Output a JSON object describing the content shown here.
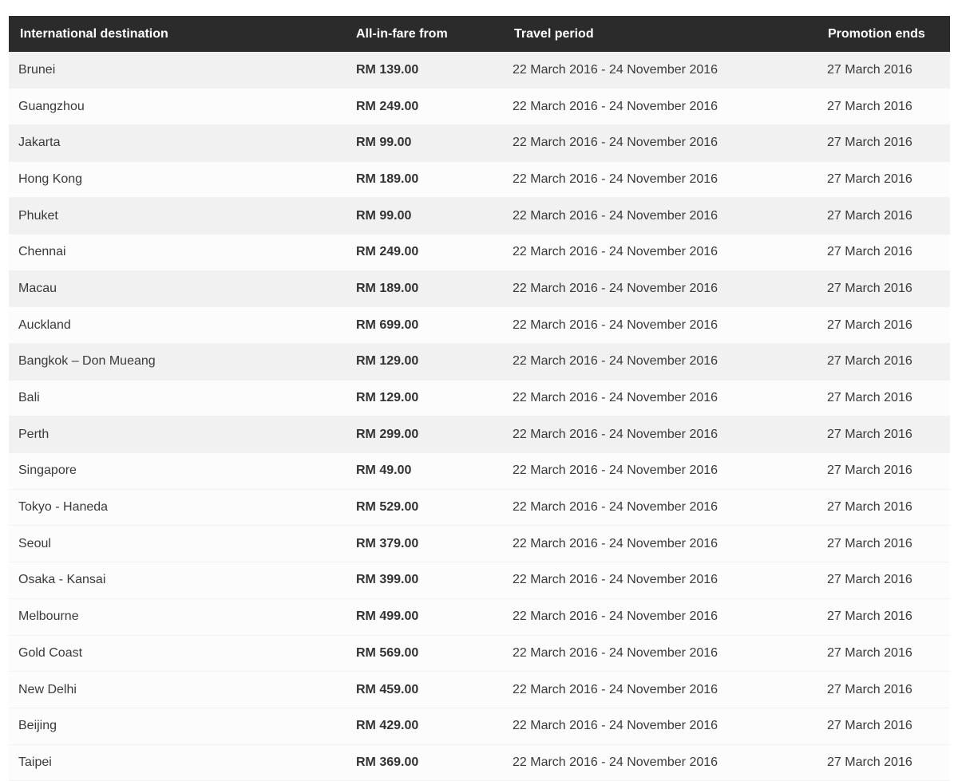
{
  "table": {
    "headers": {
      "destination": "International destination",
      "fare": "All-in-fare from",
      "period": "Travel period",
      "ends": "Promotion ends"
    },
    "rows": [
      {
        "destination": "Brunei",
        "fare": "RM 139.00",
        "period": "22 March 2016 - 24 November 2016",
        "ends": "27 March 2016"
      },
      {
        "destination": "Guangzhou",
        "fare": "RM 249.00",
        "period": "22 March 2016 - 24 November 2016",
        "ends": "27 March 2016"
      },
      {
        "destination": "Jakarta",
        "fare": "RM 99.00",
        "period": "22 March 2016 - 24 November 2016",
        "ends": "27 March 2016"
      },
      {
        "destination": "Hong Kong",
        "fare": "RM 189.00",
        "period": "22 March 2016 - 24 November 2016",
        "ends": "27 March 2016"
      },
      {
        "destination": "Phuket",
        "fare": "RM 99.00",
        "period": "22 March 2016 - 24 November 2016",
        "ends": "27 March 2016"
      },
      {
        "destination": "Chennai",
        "fare": "RM 249.00",
        "period": "22 March 2016 - 24 November 2016",
        "ends": "27 March 2016"
      },
      {
        "destination": "Macau",
        "fare": "RM 189.00",
        "period": "22 March 2016 - 24 November 2016",
        "ends": "27 March 2016"
      },
      {
        "destination": "Auckland",
        "fare": "RM 699.00",
        "period": "22 March 2016 - 24 November 2016",
        "ends": "27 March 2016"
      },
      {
        "destination": "Bangkok – Don Mueang",
        "fare": "RM 129.00",
        "period": "22 March 2016 - 24 November 2016",
        "ends": "27 March 2016"
      },
      {
        "destination": "Bali",
        "fare": "RM 129.00",
        "period": "22 March 2016 - 24 November 2016",
        "ends": "27 March 2016"
      },
      {
        "destination": "Perth",
        "fare": "RM 299.00",
        "period": "22 March 2016 - 24 November 2016",
        "ends": "27 March 2016"
      },
      {
        "destination": "Singapore",
        "fare": "RM 49.00",
        "period": "22 March 2016 - 24 November 2016",
        "ends": "27 March 2016"
      },
      {
        "destination": "Tokyo - Haneda",
        "fare": "RM 529.00",
        "period": "22 March 2016 - 24 November 2016",
        "ends": "27 March 2016"
      },
      {
        "destination": "Seoul",
        "fare": "RM 379.00",
        "period": "22 March 2016 - 24 November 2016",
        "ends": "27 March 2016"
      },
      {
        "destination": "Osaka - Kansai",
        "fare": "RM 399.00",
        "period": "22 March 2016 - 24 November 2016",
        "ends": "27 March 2016"
      },
      {
        "destination": "Melbourne",
        "fare": "RM 499.00",
        "period": "22 March 2016 - 24 November 2016",
        "ends": "27 March 2016"
      },
      {
        "destination": "Gold Coast",
        "fare": "RM 569.00",
        "period": "22 March 2016 - 24 November 2016",
        "ends": "27 March 2016"
      },
      {
        "destination": "New Delhi",
        "fare": "RM 459.00",
        "period": "22 March 2016 - 24 November 2016",
        "ends": "27 March 2016"
      },
      {
        "destination": "Beijing",
        "fare": "RM 429.00",
        "period": "22 March 2016 - 24 November 2016",
        "ends": "27 March 2016"
      },
      {
        "destination": "Taipei",
        "fare": "RM 369.00",
        "period": "22 March 2016 - 24 November 2016",
        "ends": "27 March 2016"
      }
    ]
  },
  "colors": {
    "header_bg": "#2b2b2b",
    "header_text": "#ffffff",
    "row_alt": "#f1f1f1",
    "row_plain": "#fcfcfc"
  }
}
